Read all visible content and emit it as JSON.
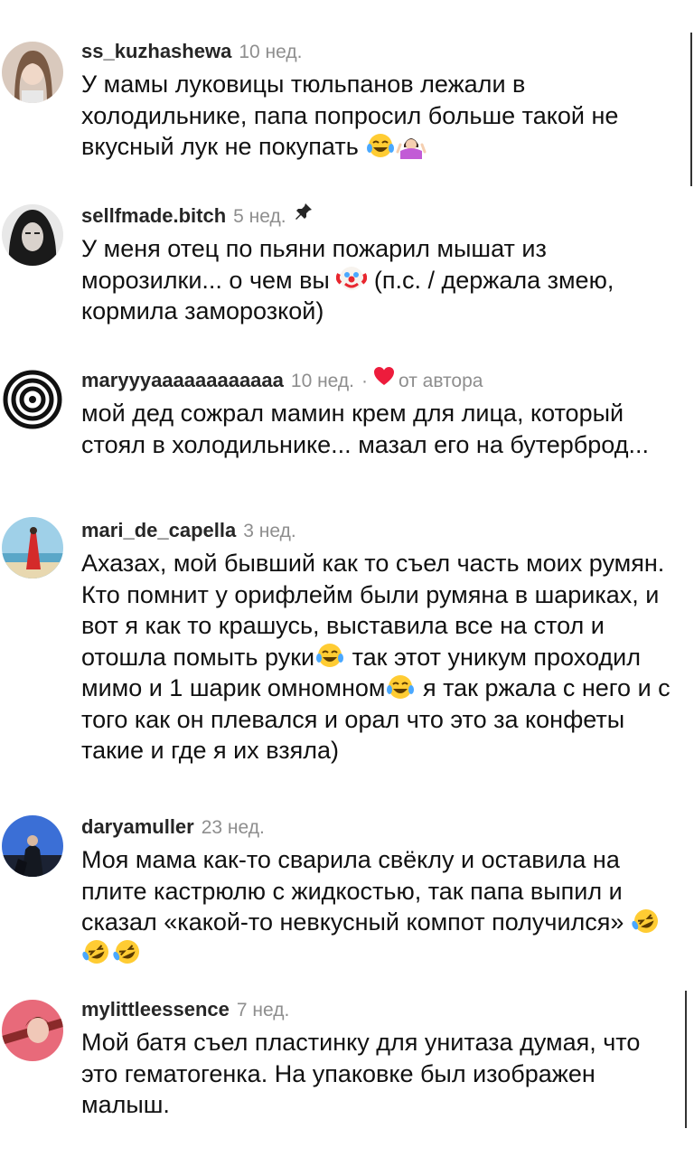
{
  "comments": [
    {
      "username": "ss_kuzhashewa",
      "time": "10 нед.",
      "parts": [
        "У мамы луковицы тюльпанов лежали в холодильнике, папа попросил больше такой не вкусный лук не покупать"
      ],
      "emojis": [
        "joy",
        "shrug"
      ],
      "avatar_colors": [
        "#d9c9bd",
        "#7a5a44"
      ]
    },
    {
      "username": "sellfmade.bitch",
      "time": "5 нед.",
      "pinned_icon": "pin-icon",
      "parts": [
        "У меня отец по пьяни пожарил мышат из морозилки... о чем вы",
        " (п.с. / держала змею, кормила заморозкой)"
      ],
      "emojis": [
        "clown"
      ],
      "avatar_colors": [
        "#e8e8e8",
        "#1a1a1a"
      ]
    },
    {
      "username": "maryyyaaaaaaaaaaaa",
      "time": "10 нед.",
      "liked_by_author": "от автора",
      "heart_color": "#ed1c3c",
      "parts": [
        "мой дед сожрал мамин крем для лица, который стоял в холодильнике... мазал его на бутерброд..."
      ],
      "avatar_colors": [
        "#ffffff",
        "#111111"
      ]
    },
    {
      "username": "mari_de_capella",
      "time": "3 нед.",
      "parts": [
        "Ахазах, мой бывший как то съел часть моих румян. Кто помнит у орифлейм были румяна в шариках, и вот я как то крашусь, выставила все на стол и отошла помыть руки",
        " так этот уникум проходил мимо и 1 шарик омномном",
        " я так ржала с него и с того как он плевался и орал что это за конфеты такие и где я их взяла)"
      ],
      "emojis": [
        "joy",
        "joy"
      ],
      "avatar_colors": [
        "#9fd0e8",
        "#d42a2a"
      ]
    },
    {
      "username": "daryamuller",
      "time": "23 нед.",
      "parts": [
        "Моя мама как-то сварила свёклу и оставила на плите кастрюлю с жидкостью, так папа выпил и сказал «какой-то невкусный компот получился»"
      ],
      "emojis": [
        "rofl",
        "rofl",
        "rofl"
      ],
      "avatar_colors": [
        "#3b6fd6",
        "#1b2233"
      ]
    },
    {
      "username": "mylittleessence",
      "time": "7 нед.",
      "parts": [
        "Мой батя съел пластинку для унитаза думая, что это гематогенка. На упаковке был изображен малыш."
      ],
      "avatar_colors": [
        "#e86a7a",
        "#8a2a2a"
      ]
    }
  ],
  "emoji_colors": {
    "face": "#ffcc33",
    "tear": "#4aa8ff",
    "clown_nose": "#e8262e",
    "shrug_hair": "#3a2a22",
    "shrug_shirt": "#c25bd6"
  }
}
